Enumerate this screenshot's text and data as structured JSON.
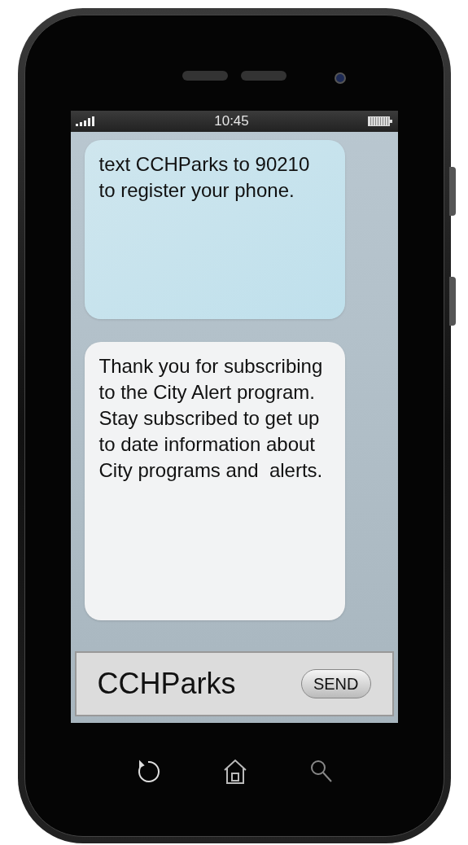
{
  "status_bar": {
    "time": "10:45"
  },
  "messages": [
    {
      "kind": "sent",
      "text": "text CCHParks to 90210 to register your phone."
    },
    {
      "kind": "received",
      "text": "Thank you for subscribing to the City Alert program. Stay subscribed to get up to date information about City programs and  alerts."
    }
  ],
  "composer": {
    "value": "CCHParks",
    "send_label": "SEND"
  }
}
